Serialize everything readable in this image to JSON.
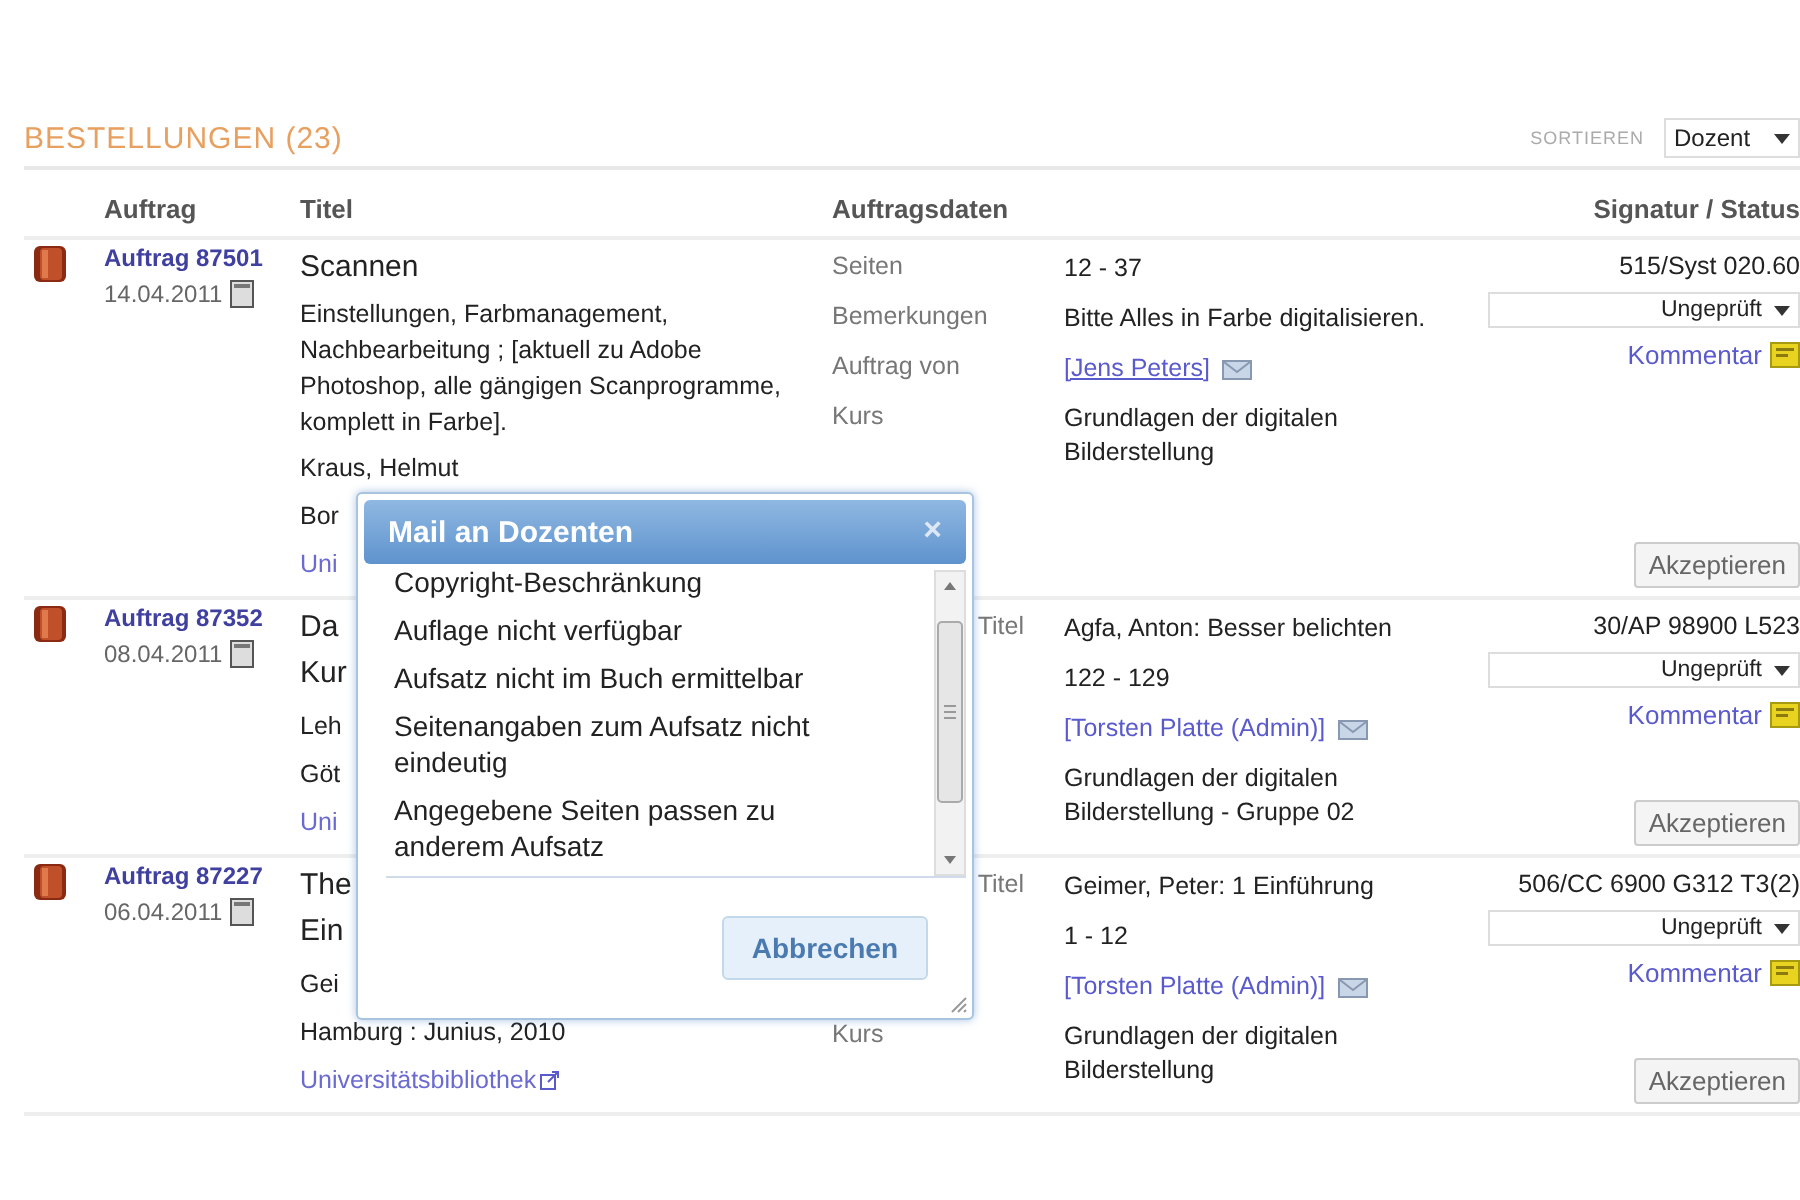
{
  "header": {
    "title": "BESTELLUNGEN (23)",
    "sort_label": "SORTIEREN",
    "sort_value": "Dozent"
  },
  "columns": [
    "Auftrag",
    "Titel",
    "Auftragsdaten",
    "Signatur / Status"
  ],
  "orders": [
    {
      "number": "Auftrag 87501",
      "date": "14.04.2011",
      "title_lines": [
        {
          "kind": "title",
          "text": "Scannen"
        },
        {
          "kind": "text",
          "text": "Einstellungen, Farbmanagement, Nachbearbeitung ; [aktuell zu Adobe Photoshop, alle gängigen Scanprogramme, komplett in Farbe]."
        },
        {
          "kind": "text",
          "text": "Kraus, Helmut"
        },
        {
          "kind": "text",
          "text": "Bor"
        },
        {
          "kind": "link",
          "text": "Uni"
        }
      ],
      "details": [
        {
          "kind": "text",
          "label": "Seiten",
          "value": "12 - 37"
        },
        {
          "kind": "text",
          "label": "Bemerkungen",
          "value": "Bitte Alles in Farbe digitalisieren."
        },
        {
          "kind": "mail",
          "label": "Auftrag von",
          "value": "[Jens Peters]"
        },
        {
          "kind": "text",
          "label": "Kurs",
          "value": "Grundlagen der digitalen Bilderstellung"
        }
      ],
      "signature": "515/Syst 020.60",
      "status": "Ungeprüft",
      "comment": "Kommentar",
      "accept": "Akzeptieren"
    },
    {
      "number": "Auftrag 87352",
      "date": "08.04.2011",
      "title_lines": [
        {
          "kind": "title",
          "text": "Da"
        },
        {
          "kind": "title",
          "text": "Kur"
        },
        {
          "kind": "text",
          "text": "Leh"
        },
        {
          "kind": "text",
          "text": "Göt"
        },
        {
          "kind": "link",
          "text": "Uni"
        }
      ],
      "details": [
        {
          "kind": "text",
          "label": "Titel",
          "value": "Agfa, Anton: Besser belichten"
        },
        {
          "kind": "text",
          "value": "122 - 129"
        },
        {
          "kind": "mail",
          "value": "[Torsten Platte (Admin)]"
        },
        {
          "kind": "text",
          "value": "Grundlagen der digitalen Bilderstellung - Gruppe 02"
        }
      ],
      "signature": "30/AP 98900 L523",
      "status": "Ungeprüft",
      "comment": "Kommentar",
      "accept": "Akzeptieren"
    },
    {
      "number": "Auftrag 87227",
      "date": "06.04.2011",
      "title_lines": [
        {
          "kind": "title",
          "text": "The"
        },
        {
          "kind": "title",
          "text": "Ein"
        },
        {
          "kind": "text",
          "text": "Gei"
        },
        {
          "kind": "text",
          "text": "Hamburg : Junius, 2010"
        },
        {
          "kind": "extlink",
          "text": "Universitätsbibliothek"
        }
      ],
      "details": [
        {
          "kind": "text",
          "label": "Titel",
          "value": "Geimer, Peter: 1 Einführung"
        },
        {
          "kind": "text",
          "value": "1 - 12"
        },
        {
          "kind": "mail",
          "value": "[Torsten Platte (Admin)]"
        },
        {
          "kind": "text",
          "label": "Kurs",
          "value": "Grundlagen der digitalen Bilderstellung"
        }
      ],
      "signature": "506/CC 6900 G312 T3(2)",
      "status": "Ungeprüft",
      "comment": "Kommentar",
      "accept": "Akzeptieren"
    }
  ],
  "dialog": {
    "title": "Mail an Dozenten",
    "close": "×",
    "items": [
      {
        "text": "Copyright-Beschränkung",
        "selected": false
      },
      {
        "text": "Auflage nicht verfügbar",
        "selected": false
      },
      {
        "text": "Aufsatz nicht im Buch ermittelbar",
        "selected": false
      },
      {
        "text": "Seitenangaben zum Aufsatz nicht eindeutig",
        "selected": false
      },
      {
        "text": "Angegebene Seiten passen zu anderem Aufsatz",
        "selected": false
      }
    ],
    "cancel": "Abbrechen"
  }
}
